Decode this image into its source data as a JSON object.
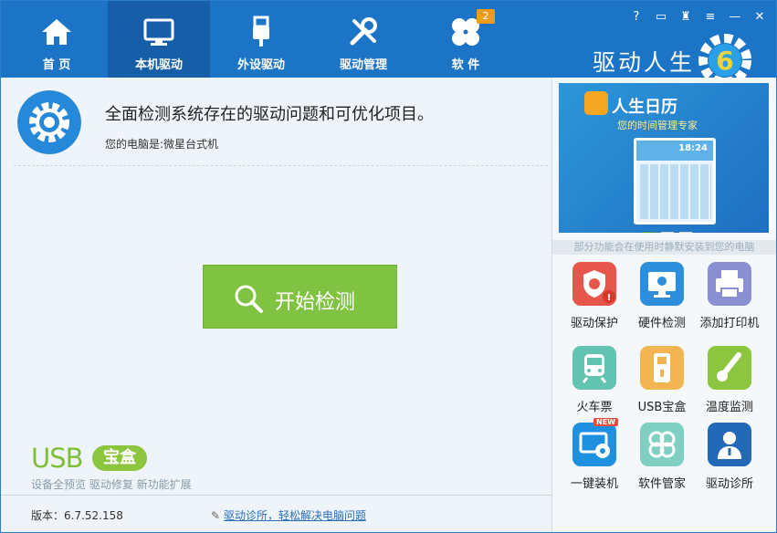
{
  "nav": {
    "items": [
      {
        "label": "首 页",
        "icon": "home-icon"
      },
      {
        "label": "本机驱动",
        "icon": "monitor-icon"
      },
      {
        "label": "外设驱动",
        "icon": "usb-plug-icon"
      },
      {
        "label": "驱动管理",
        "icon": "tools-icon"
      },
      {
        "label": "软 件",
        "icon": "apps-icon"
      }
    ],
    "software_badge": "2",
    "active_index": 1
  },
  "brand": {
    "name": "驱动人生",
    "version_mark": "6"
  },
  "main": {
    "headline": "全面检测系统存在的驱动问题和可优化项目。",
    "computer_info": "您的电脑是:微星台式机",
    "start_button": "开始检测"
  },
  "usb_box": {
    "logo_text": "USB",
    "logo_badge": "宝盒",
    "subtitle": "设备全预览 驱动修复 新功能扩展"
  },
  "footer": {
    "version": "版本：6.7.52.158",
    "clinic_link": "驱动诊所，轻松解决电脑问题"
  },
  "banner": {
    "title": "人生日历",
    "subtitle": "您的时间管理专家",
    "phone_time": "18:24"
  },
  "promo_text": "部分功能会在使用时静默安装到您的电脑",
  "tools": [
    {
      "label": "驱动保护",
      "icon": "shield-gear-icon",
      "color": "#e6564a"
    },
    {
      "label": "硬件检测",
      "icon": "monitor-gear-icon",
      "color": "#2d8fdc"
    },
    {
      "label": "添加打印机",
      "icon": "printer-icon",
      "color": "#8a8fd1"
    },
    {
      "label": "火车票",
      "icon": "train-icon",
      "color": "#62c3b0"
    },
    {
      "label": "USB宝盒",
      "icon": "usb-icon",
      "color": "#f2b552"
    },
    {
      "label": "温度监测",
      "icon": "thermometer-icon",
      "color": "#8cc63f"
    },
    {
      "label": "一键装机",
      "icon": "install-disc-icon",
      "color": "#1f8fe0",
      "tag": "NEW"
    },
    {
      "label": "软件管家",
      "icon": "clover-icon",
      "color": "#7fd0c2"
    },
    {
      "label": "驱动诊所",
      "icon": "doctor-icon",
      "color": "#2469b8"
    }
  ],
  "colors": {
    "topbar": "#1b74c6",
    "active_tab": "#165ea8",
    "start_button": "#80c342",
    "badge": "#f29a1c"
  }
}
